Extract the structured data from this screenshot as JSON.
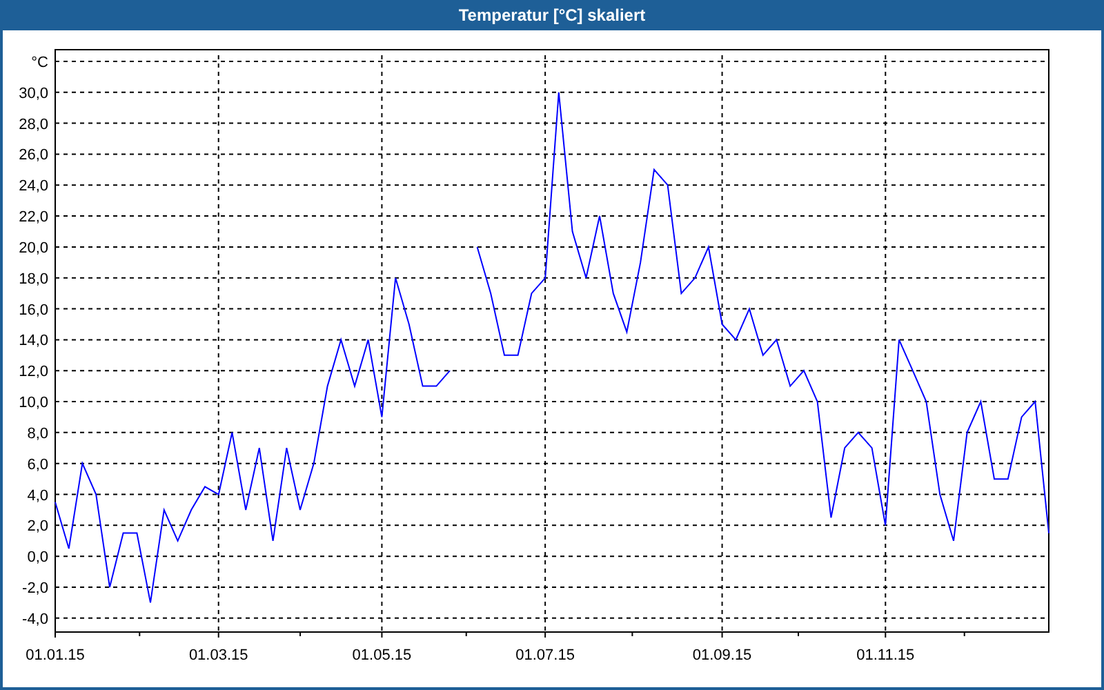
{
  "window": {
    "title": "Temperatur [°C] skaliert"
  },
  "chart": {
    "chart_data": {
      "type": "line",
      "categories": [
        "01.01.15",
        null,
        null,
        null,
        null,
        null,
        null,
        null,
        null,
        null,
        null,
        null,
        "01.03.15",
        null,
        null,
        null,
        null,
        null,
        null,
        null,
        null,
        null,
        null,
        null,
        "01.05.15",
        null,
        null,
        null,
        null,
        null,
        null,
        null,
        null,
        null,
        null,
        null,
        "01.07.15",
        null,
        null,
        null,
        null,
        null,
        null,
        null,
        null,
        null,
        null,
        null,
        null,
        "01.09.15",
        null,
        null,
        null,
        null,
        null,
        null,
        null,
        null,
        null,
        null,
        null,
        "01.11.15",
        null,
        null,
        null,
        null,
        null,
        null,
        null,
        null,
        null,
        null,
        null,
        null
      ],
      "series": [
        {
          "color": "#0000ff",
          "values": [
            3.5,
            0.5,
            6,
            4,
            -2,
            1.5,
            1.5,
            -3,
            3,
            1,
            3,
            4.5,
            4,
            8,
            3,
            7,
            1,
            7,
            3,
            6,
            11,
            14,
            11,
            14,
            9,
            18,
            15,
            11,
            11,
            12,
            null,
            20,
            17,
            13,
            13,
            17,
            18,
            30,
            21,
            18,
            22,
            17,
            14.5,
            19,
            25,
            24,
            17,
            18,
            20,
            15,
            14,
            16,
            13,
            14,
            11,
            12,
            10,
            2.5,
            7,
            8,
            7,
            2,
            14,
            12,
            10,
            4,
            1,
            8,
            10,
            5,
            5,
            9,
            10,
            1.5
          ]
        }
      ],
      "grid": true,
      "ylim": [
        -4.9,
        32.4
      ],
      "yticks": [
        {
          "value": -4,
          "label": "-4,0"
        },
        {
          "value": -2,
          "label": "-2,0"
        },
        {
          "value": 0,
          "label": "0,0"
        },
        {
          "value": 2,
          "label": "2,0"
        },
        {
          "value": 4,
          "label": "4,0"
        },
        {
          "value": 6,
          "label": "6,0"
        },
        {
          "value": 8,
          "label": "8,0"
        },
        {
          "value": 10,
          "label": "10,0"
        },
        {
          "value": 12,
          "label": "12,0"
        },
        {
          "value": 14,
          "label": "14,0"
        },
        {
          "value": 16,
          "label": "16,0"
        },
        {
          "value": 18,
          "label": "18,0"
        },
        {
          "value": 20,
          "label": "20,0"
        },
        {
          "value": 22,
          "label": "22,0"
        },
        {
          "value": 24,
          "label": "24,0"
        },
        {
          "value": 26,
          "label": "26,0"
        },
        {
          "value": 28,
          "label": "28,0"
        },
        {
          "value": 30,
          "label": "30,0"
        },
        {
          "value": 32,
          "label": "°C"
        }
      ]
    }
  }
}
